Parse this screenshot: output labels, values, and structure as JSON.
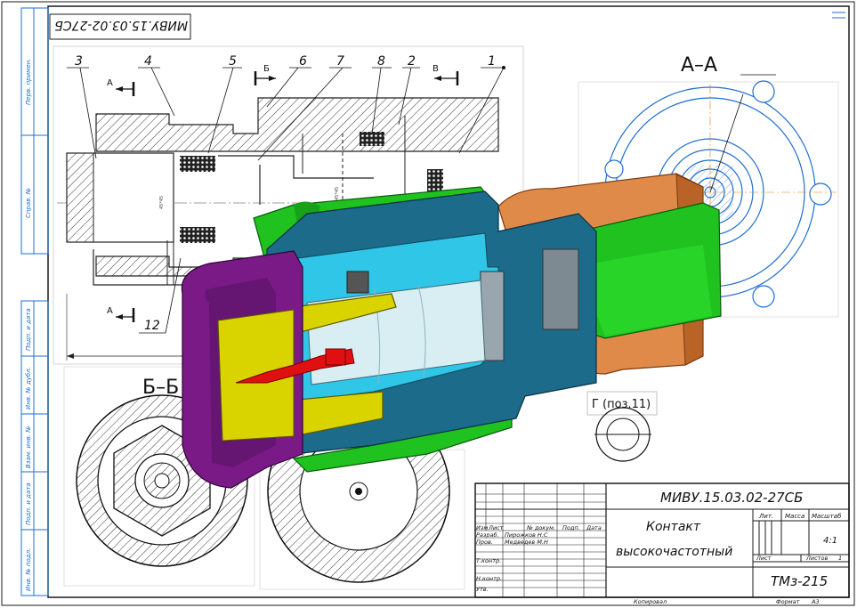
{
  "drawing": {
    "designation": "МИВУ.15.03.02-27СБ",
    "designation_rotated": "МИВУ.15.03.02-27СБ",
    "section_aa": "А–А",
    "section_bb": "Б–Б",
    "view_g": "Г (поз.11)",
    "cut_a": "А",
    "cut_b": "Б",
    "cut_v": "В",
    "center_mark": "45*45",
    "part_numbers": [
      "3",
      "4",
      "5",
      "6",
      "7",
      "8",
      "2",
      "1",
      "12"
    ]
  },
  "side_stamp": [
    "Перв. примен.",
    "Справ. №",
    "Подп. и дата",
    "Инв. № дубл.",
    "Взам. инв. №",
    "Подп. и дата",
    "Инв. № подл."
  ],
  "title_block": {
    "designation": "МИВУ.15.03.02-27СБ",
    "name_line1": "Контакт",
    "name_line2": "высокочастотный",
    "col_headers": [
      "Изм",
      "Лист",
      "№ докум.",
      "Подп.",
      "Дата"
    ],
    "roles": [
      "Разраб.",
      "Пров.",
      "Т.контр.",
      "",
      "Н.контр.",
      "Утв."
    ],
    "people": [
      "Пирожков Н.С",
      "Медведев М.Н"
    ],
    "lit_label": "Лит.",
    "mass_label": "Масса",
    "scale_label": "Масштаб",
    "scale_value": "4:1",
    "sheet_label": "Лист",
    "sheets_label": "Листов",
    "sheets_value": "1",
    "org": "ТМз-215",
    "copied": "Копировал",
    "format_label": "Формат",
    "format_value": "А3"
  },
  "colors": {
    "frame": "#1b1b1b",
    "blue_line": "#1f6ed4",
    "magenta": "#7a1a86",
    "green": "#1fc21f",
    "teal": "#1c6b8a",
    "cyan": "#2fc6e8",
    "orange": "#e08a4a",
    "yellow": "#d9d400",
    "red": "#e01010",
    "gray": "#7d8a92"
  }
}
